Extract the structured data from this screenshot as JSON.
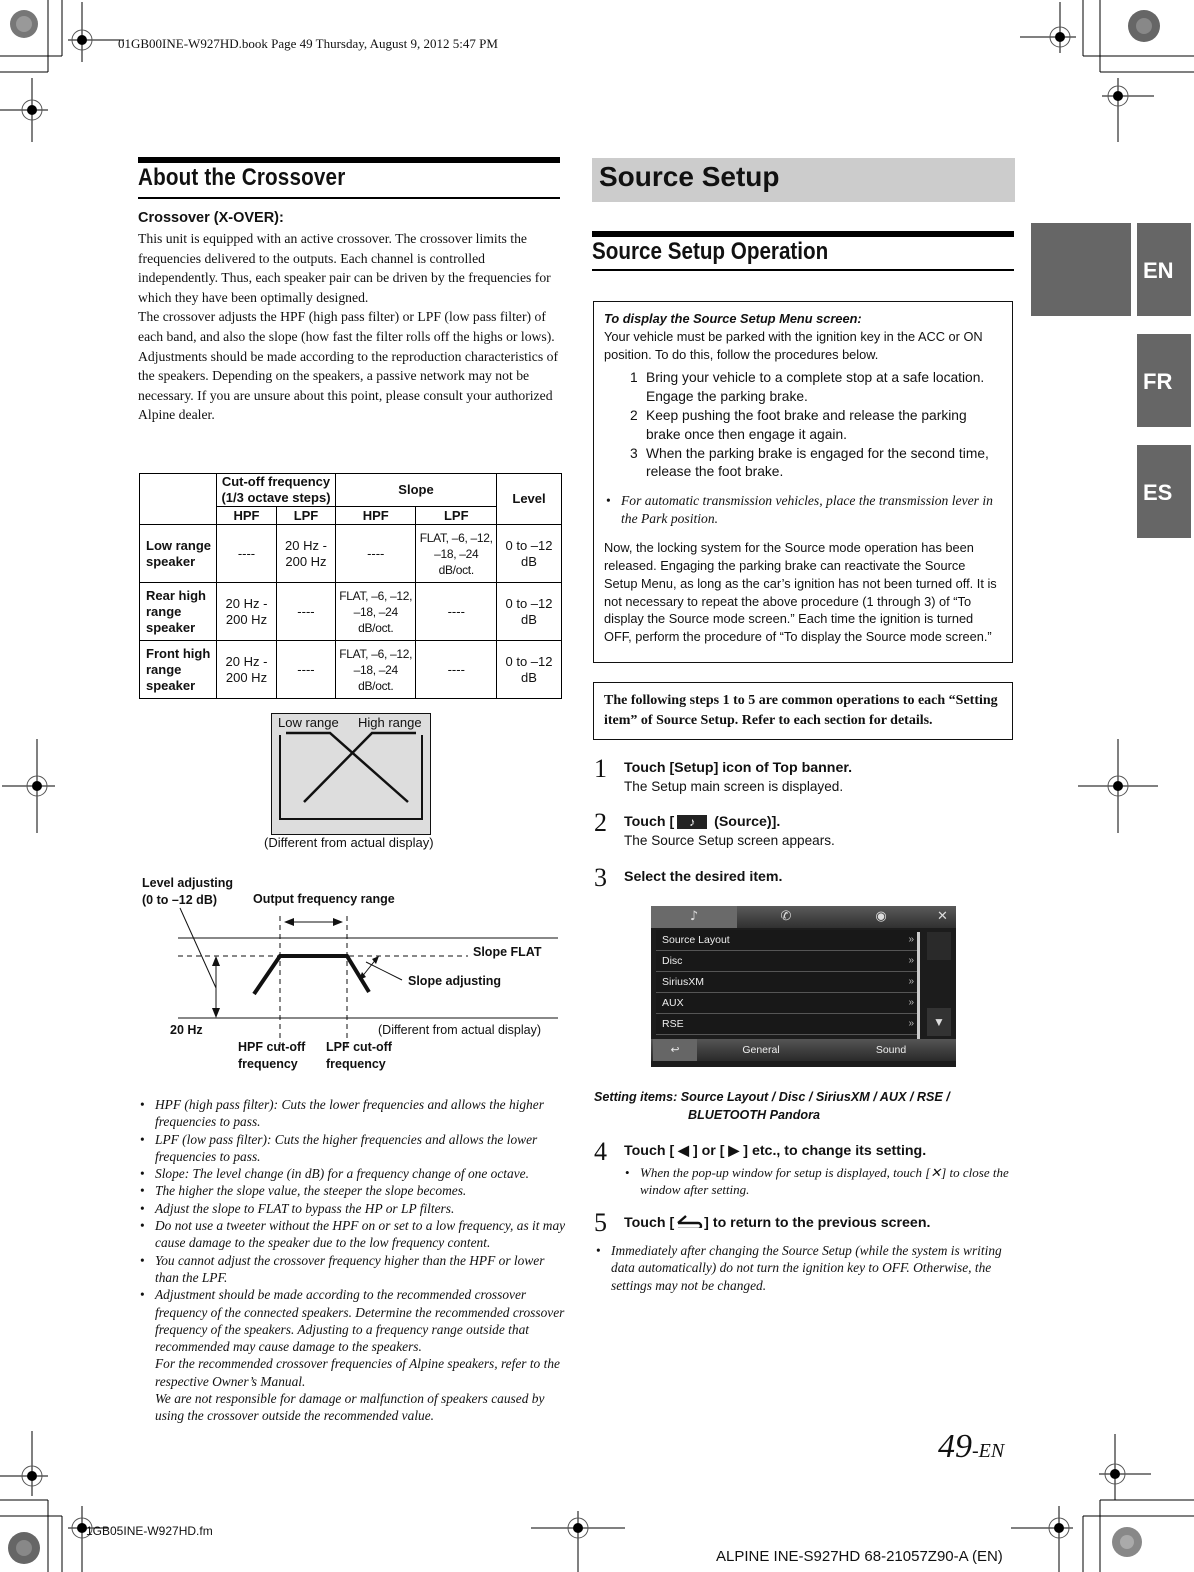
{
  "header": {
    "book_info": "01GB00INE-W927HD.book  Page 49  Thursday, August 9, 2012  5:47 PM"
  },
  "footer": {
    "fm_file": "1GB05INE-W927HD.fm",
    "model_info": "ALPINE INE-S927HD 68-21057Z90-A (EN)",
    "page_number": "49",
    "page_suffix": "-EN"
  },
  "lang_tabs": [
    "EN",
    "FR",
    "ES"
  ],
  "left": {
    "heading": "About the Crossover",
    "subheading": "Crossover (X-OVER):",
    "paragraphs": [
      "This unit is equipped with an active crossover. The crossover limits the frequencies delivered to the outputs. Each channel is controlled independently. Thus, each speaker pair can be driven by the frequencies for which they have been optimally designed.",
      "The crossover adjusts the HPF (high pass filter) or LPF (low pass filter) of each band, and also the slope (how fast the filter rolls off the highs or lows).",
      "Adjustments should be made according to the reproduction characteristics of the speakers. Depending on the speakers, a passive network may not be necessary. If you are unsure about this point, please consult your authorized Alpine dealer."
    ],
    "table": {
      "group_headers": [
        "Cut-off frequency (1/3 octave steps)",
        "Slope",
        "Level"
      ],
      "sub_headers": [
        "HPF",
        "LPF",
        "HPF",
        "LPF"
      ],
      "rows": [
        {
          "speaker": "Low range speaker",
          "cut_hpf": "----",
          "cut_lpf": "20 Hz - 200 Hz",
          "slope_hpf": "----",
          "slope_lpf": "FLAT, –6, –12, –18, –24 dB/oct.",
          "level": "0 to –12 dB"
        },
        {
          "speaker": "Rear high range speaker",
          "cut_hpf": "20 Hz - 200 Hz",
          "cut_lpf": "----",
          "slope_hpf": "FLAT, –6, –12, –18, –24 dB/oct.",
          "slope_lpf": "----",
          "level": "0 to –12 dB"
        },
        {
          "speaker": "Front high range speaker",
          "cut_hpf": "20 Hz - 200 Hz",
          "cut_lpf": "----",
          "slope_hpf": "FLAT, –6, –12, –18, –24 dB/oct.",
          "slope_lpf": "----",
          "level": "0 to –12 dB"
        }
      ]
    },
    "figure1": {
      "low_label": "Low range",
      "high_label": "High range",
      "caption": "(Different from actual display)"
    },
    "figure2": {
      "level_adjusting": "Level adjusting",
      "level_range": "(0 to –12 dB)",
      "output_range": "Output frequency range",
      "slope_flat": "Slope FLAT",
      "slope_adjusting": "Slope adjusting",
      "freq_20hz": "20 Hz",
      "caption": "(Different from actual display)",
      "hpf_cutoff_1": "HPF cut-off",
      "hpf_cutoff_2": "frequency",
      "lpf_cutoff_1": "LPF cut-off",
      "lpf_cutoff_2": "frequency"
    },
    "notes": [
      "HPF (high pass filter): Cuts the lower frequencies and allows the higher frequencies to pass.",
      "LPF (low pass filter): Cuts the higher frequencies and allows the lower frequencies to pass.",
      "Slope: The level change (in dB) for a frequency change of one octave.",
      "The higher the slope value, the steeper the slope becomes.",
      "Adjust the slope to FLAT to bypass the HP or LP filters.",
      "Do not use a tweeter without the HPF on or set to a low frequency, as it may cause damage to the speaker due to the low frequency content.",
      "You cannot adjust the crossover frequency higher than the HPF or lower than the LPF.",
      "Adjustment should be made according to the recommended crossover frequency of the connected speakers. Determine the recommended crossover frequency of the speakers. Adjusting to a frequency range outside that recommended may cause damage to the speakers.",
      "For the recommended crossover frequencies of Alpine speakers, refer to the respective Owner’s Manual.",
      "We are not responsible for damage or malfunction of speakers caused by using the crossover outside the recommended value."
    ]
  },
  "right": {
    "banner": "Source Setup",
    "heading": "Source Setup Operation",
    "box1": {
      "title": "To display the Source Setup Menu screen:",
      "intro": "Your vehicle must be parked with the ignition key in the ACC or ON position. To do this, follow the procedures below.",
      "steps": [
        {
          "n": "1",
          "text": "Bring your vehicle to a complete stop at a safe location. Engage the parking brake."
        },
        {
          "n": "2",
          "text": "Keep pushing the foot brake and release the parking brake once then engage it again."
        },
        {
          "n": "3",
          "text": "When the parking brake is engaged for the second time, release the foot brake."
        }
      ],
      "note": "For automatic transmission vehicles, place the transmission lever in the Park position.",
      "para": "Now, the locking system for the Source mode operation has been released. Engaging the parking brake can reactivate the Source Setup Menu, as long as the car’s ignition has not been turned off. It is not necessary to repeat the above procedure (1 through 3) of “To display the Source mode screen.” Each time the ignition is turned OFF, perform the procedure of “To display the Source mode screen.”"
    },
    "box2": "The following steps 1 to 5 are common operations to each “Setting item” of Source Setup. Refer to each section for details.",
    "steps": [
      {
        "num": "1",
        "title": "Touch [Setup] icon of  Top banner.",
        "sub": "The Setup main screen is displayed."
      },
      {
        "num": "2",
        "title_pre": "Touch [",
        "title_icon": "♪",
        "title_post": " (Source)].",
        "sub": "The Source Setup screen appears."
      },
      {
        "num": "3",
        "title": "Select the desired item."
      },
      {
        "num": "4",
        "title": "Touch [ ◀ ] or [ ▶ ] etc., to change its setting.",
        "sub": "When the pop-up window for setup is displayed, touch [✕] to close the window after setting."
      },
      {
        "num": "5",
        "title_pre": "Touch [",
        "title_post": "] to return to the previous screen."
      }
    ],
    "screen": {
      "tabs": [
        "♪",
        "✆",
        "◉",
        "✕"
      ],
      "items": [
        "Source Layout",
        "Disc",
        "SiriusXM",
        "AUX",
        "RSE"
      ],
      "chevron": "»",
      "down_arrow": "▼",
      "bottom": {
        "back": "↩",
        "general": "General",
        "sound": "Sound"
      }
    },
    "setting_items_label": "Setting items:",
    "setting_items_line1": "Source Layout / Disc / SiriusXM / AUX / RSE /",
    "setting_items_line2": "BLUETOOTH Pandora",
    "final_note": "Immediately after changing the Source Setup (while the system is writing data automatically) do not turn the ignition key to OFF. Otherwise, the settings may not be changed."
  }
}
